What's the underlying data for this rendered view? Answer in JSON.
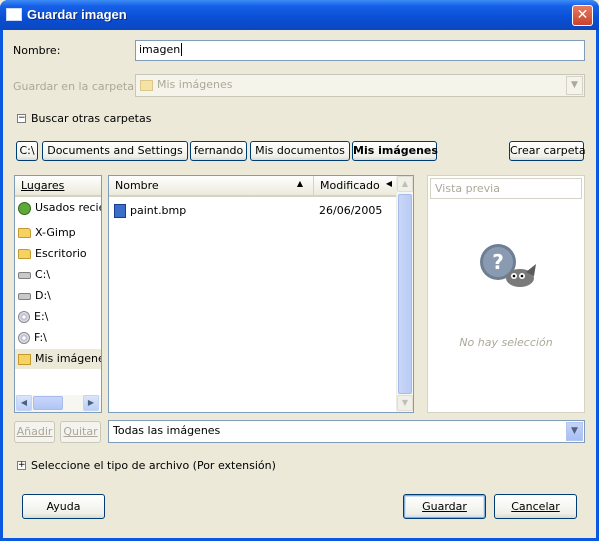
{
  "window": {
    "title": "Guardar imagen",
    "close_label": "✕"
  },
  "name_field": {
    "label": "Nombre:",
    "value": "imagen"
  },
  "folder_field": {
    "label": "Guardar en la carpeta:",
    "value": "Mis imágenes",
    "arrow": "▼"
  },
  "browse": {
    "label": "Buscar otras carpetas",
    "expander": "−"
  },
  "path_bar": {
    "buttons": [
      "C:\\",
      "Documents and Settings",
      "fernando",
      "Mis documentos",
      "Mis imágenes"
    ],
    "selected_index": 4,
    "create_folder": "Crear carpeta"
  },
  "places": {
    "header": "Lugares",
    "items": [
      {
        "label": "Usados recientemente",
        "icon": "recent-icon"
      },
      {
        "label": "X-Gimp",
        "icon": "folder-icon"
      },
      {
        "label": "Escritorio",
        "icon": "folder-icon"
      },
      {
        "label": "C:\\",
        "icon": "drive-icon"
      },
      {
        "label": "D:\\",
        "icon": "drive-icon"
      },
      {
        "label": "E:\\",
        "icon": "cdrom-icon"
      },
      {
        "label": "F:\\",
        "icon": "cdrom-icon"
      },
      {
        "label": "Mis imágenes",
        "icon": "pictures-folder-icon"
      }
    ],
    "add_button": "Añadir",
    "remove_button": "Quitar"
  },
  "files": {
    "col_name": "Nombre",
    "col_modified": "Modificado",
    "sort_up": "▲",
    "sort_left": "◀",
    "rows": [
      {
        "name": "paint.bmp",
        "date": "26/06/2005"
      }
    ]
  },
  "preview": {
    "header": "Vista previa",
    "empty_text": "No hay selección"
  },
  "filter": {
    "value": "Todas las imágenes",
    "arrow": "▼"
  },
  "file_type": {
    "label": "Seleccione el tipo de archivo (Por extensión)",
    "expander": "+"
  },
  "buttons": {
    "help": "Ayuda",
    "save": "Guardar",
    "cancel": "Cancelar"
  },
  "colors": {
    "title_blue": "#0a4fd4",
    "dialog_bg": "#ece9d8",
    "selection_bg": "#ece9d8"
  }
}
